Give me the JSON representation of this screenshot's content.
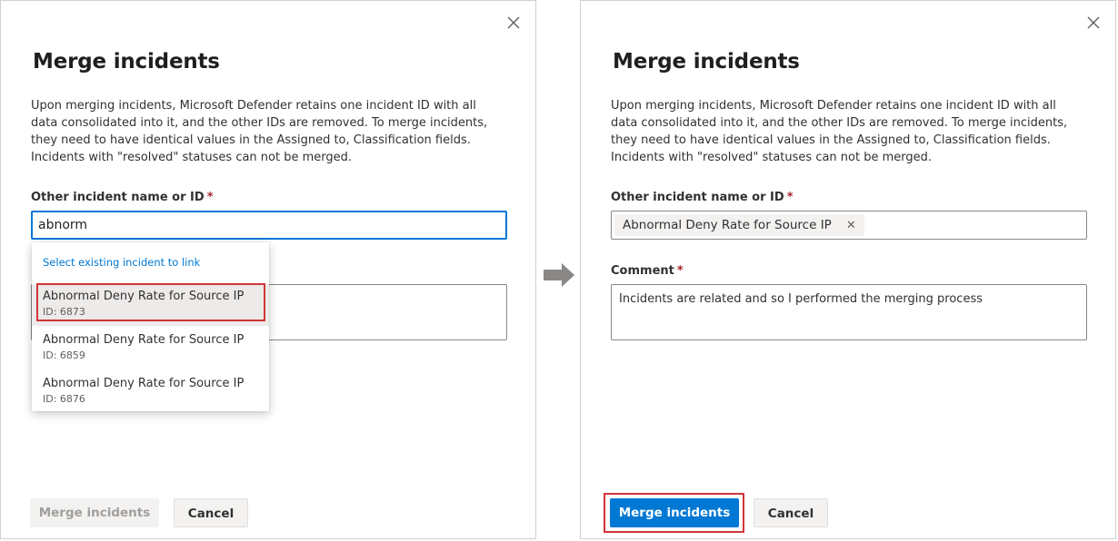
{
  "left": {
    "title": "Merge incidents",
    "description": "Upon merging incidents, Microsoft Defender retains one incident ID with all data consolidated into it, and the other IDs are removed. To merge incidents, they need to have identical values in the Assigned to, Classification fields. Incidents with \"resolved\" statuses can not be merged.",
    "incident_label": "Other incident name or ID",
    "required_mark": "*",
    "incident_value": "abnorm",
    "dropdown": {
      "header": "Select existing incident to link",
      "items": [
        {
          "name": "Abnormal Deny Rate for Source IP",
          "id": "ID: 6873"
        },
        {
          "name": "Abnormal Deny Rate for Source IP",
          "id": "ID: 6859"
        },
        {
          "name": "Abnormal Deny Rate for Source IP",
          "id": "ID: 6876"
        }
      ]
    },
    "merge_label": "Merge incidents",
    "cancel_label": "Cancel"
  },
  "right": {
    "title": "Merge incidents",
    "description": "Upon merging incidents, Microsoft Defender retains one incident ID with all data consolidated into it, and the other IDs are removed. To merge incidents, they need to have identical values in the Assigned to, Classification fields. Incidents with \"resolved\" statuses can not be merged.",
    "incident_label": "Other incident name or ID",
    "required_mark": "*",
    "selected_tag": "Abnormal Deny Rate for Source IP",
    "comment_label": "Comment",
    "comment_value": "Incidents are related and so I performed the merging process",
    "merge_label": "Merge incidents",
    "cancel_label": "Cancel"
  },
  "colors": {
    "accent": "#0078d4",
    "highlight": "#d13438",
    "required": "#a4262c"
  },
  "icons": {
    "close": "close-icon",
    "arrow": "arrow-right-icon",
    "tag_remove": "close-icon"
  }
}
